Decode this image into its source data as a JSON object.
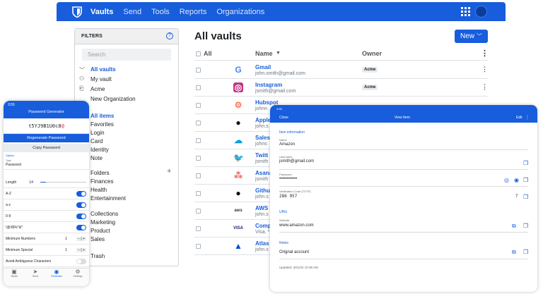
{
  "topnav": {
    "items": [
      "Vaults",
      "Send",
      "Tools",
      "Reports",
      "Organizations"
    ],
    "active": "Vaults",
    "icons": [
      "shield-logo-icon",
      "apps-grid-icon",
      "avatar-icon"
    ],
    "color": "#175ddc"
  },
  "filters": {
    "title": "FILTERS",
    "search_placeholder": "Search",
    "vaults": [
      "All vaults",
      "My vault",
      "Acme",
      "New Organization"
    ],
    "types": [
      "All items",
      "Favorites",
      "Login",
      "Card",
      "Identity",
      "Note"
    ],
    "folders_label": "Folders",
    "folders": [
      "Finances",
      "Health",
      "Entertainment"
    ],
    "collections_label": "Collections",
    "collections": [
      "Marketing",
      "Product",
      "Sales"
    ],
    "trash": "Trash"
  },
  "main": {
    "title": "All vaults",
    "new_button": "New",
    "columns": [
      "All",
      "Name",
      "Owner"
    ],
    "rows": [
      {
        "name": "Gmail",
        "sub": "john.smith@gmail.com",
        "owner": "Acme",
        "icon": "google-icon"
      },
      {
        "name": "Instagram",
        "sub": "jsmith@gmail.com",
        "owner": "Acme",
        "icon": "instagram-icon"
      },
      {
        "name": "Hubspot",
        "sub": "johnn",
        "owner": "",
        "icon": "hubspot-icon"
      },
      {
        "name": "Apple",
        "sub": "john.s",
        "owner": "",
        "icon": "apple-icon"
      },
      {
        "name": "Sales",
        "sub": "johns",
        "owner": "",
        "icon": "salesforce-icon"
      },
      {
        "name": "Twitt",
        "sub": "jsmith",
        "owner": "",
        "icon": "twitter-icon"
      },
      {
        "name": "Asana",
        "sub": "jsmith",
        "owner": "",
        "icon": "asana-icon"
      },
      {
        "name": "Githu",
        "sub": "john.s",
        "owner": "",
        "icon": "github-icon"
      },
      {
        "name": "AWS",
        "sub": "john.s",
        "owner": "",
        "icon": "aws-icon"
      },
      {
        "name": "Comp",
        "sub": "Visa, *",
        "owner": "",
        "icon": "visa-icon"
      },
      {
        "name": "Atlas",
        "sub": "john.s",
        "owner": "",
        "icon": "atlassian-icon"
      }
    ]
  },
  "phone": {
    "time": "3:55",
    "title": "Password Generator",
    "password": "t5YJ9B1U0c8",
    "password_accent": "@",
    "regen": "Regenerate Password",
    "copy": "Copy Password",
    "options_label": "Options",
    "type_label": "Type",
    "type_value": "Password",
    "length_label": "Length",
    "length_value": "14",
    "toggles": [
      "A-Z",
      "a-z",
      "0-9",
      "!@#$%^&*"
    ],
    "min_numbers": "Minimum Numbers",
    "min_numbers_val": "1",
    "min_special": "Minimum Special",
    "min_special_val": "1",
    "avoid": "Avoid Ambiguous Characters",
    "tabs": [
      "Vaults",
      "Send",
      "Generator",
      "Settings"
    ]
  },
  "tablet": {
    "time": "3:55",
    "close": "Close",
    "title": "View Item",
    "edit": "Edit",
    "section_info": "Item information",
    "name_label": "Name",
    "name_value": "Amazon",
    "username_label": "Username",
    "username_value": "jsmith@gmail.com",
    "password_label": "Password",
    "password_value": "••••••••••••",
    "totp_label": "Verification Code (TOTP)",
    "totp_value": "286  957",
    "totp_timer": "7",
    "uris": "URIs",
    "website_label": "Website",
    "website_value": "www.amazon.com",
    "notes": "Notes",
    "notes_value": "Orignal account",
    "updated": "Updated: 3/21/22 10:38 AM"
  }
}
